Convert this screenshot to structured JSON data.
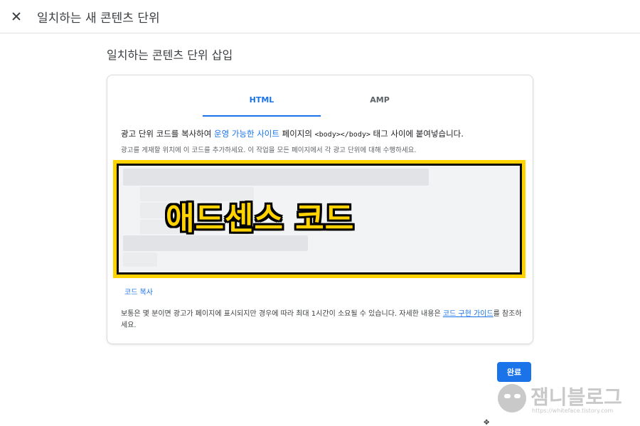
{
  "header": {
    "title": "일치하는 새 콘텐츠 단위",
    "close_icon": "close-icon"
  },
  "section": {
    "title": "일치하는 콘텐츠 단위 삽입"
  },
  "tabs": [
    {
      "label": "HTML",
      "active": true
    },
    {
      "label": "AMP",
      "active": false
    }
  ],
  "instructions": {
    "prefix": "광고 단위 코드를 복사하여 ",
    "link": "운영 가능한 사이트",
    "middle": " 페이지의 ",
    "tag": "<body></body>",
    "suffix": " 태그 사이에 붙여넣습니다.",
    "sub": "광고를 게재할 위치에 이 코드를 추가하세요. 이 작업을 모든 페이지에서 각 광고 단위에 대해 수행하세요."
  },
  "code_box": {
    "overlay_text": "애드센스 코드"
  },
  "copy_code_label": "코드 복사",
  "note": {
    "text": "보통은 몇 분이면 광고가 페이지에 표시되지만 경우에 따라 최대 1시간이 소요될 수 있습니다. 자세한 내용은 ",
    "link": "코드 구현 가이드",
    "suffix": "를 참조하세요."
  },
  "done_button_label": "완료",
  "watermark": {
    "title": "잼니블로그",
    "url": "https://whiteface.tistory.com"
  },
  "colors": {
    "accent": "#1a73e8",
    "highlight": "#ffd200"
  }
}
